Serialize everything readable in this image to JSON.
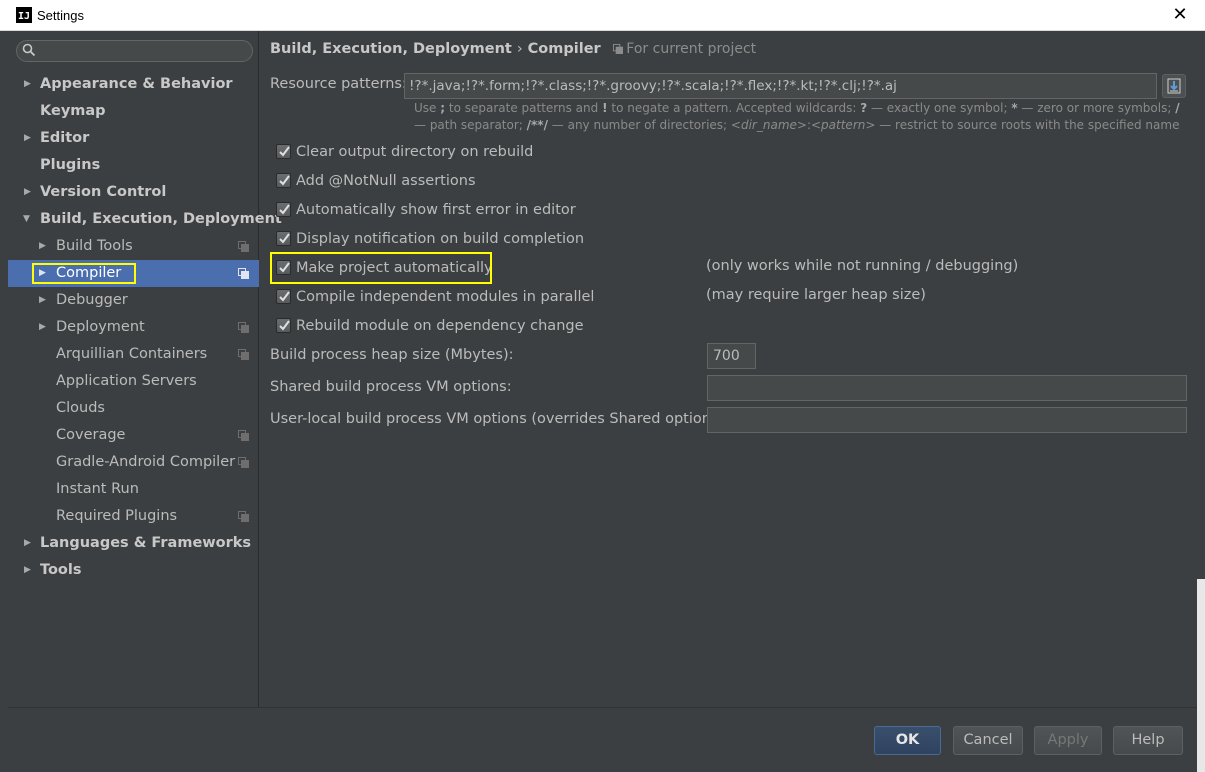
{
  "window": {
    "title": "Settings"
  },
  "search": {
    "placeholder": ""
  },
  "sidebar": {
    "items": [
      {
        "label": "Appearance & Behavior",
        "arrow": "▶"
      },
      {
        "label": "Keymap"
      },
      {
        "label": "Editor",
        "arrow": "▶"
      },
      {
        "label": "Plugins"
      },
      {
        "label": "Version Control",
        "arrow": "▶"
      },
      {
        "label": "Build, Execution, Deployment",
        "arrow": "▼"
      },
      {
        "label": "Build Tools",
        "arrow": "▶"
      },
      {
        "label": "Compiler",
        "arrow": "▶"
      },
      {
        "label": "Debugger",
        "arrow": "▶"
      },
      {
        "label": "Deployment",
        "arrow": "▶"
      },
      {
        "label": "Arquillian Containers"
      },
      {
        "label": "Application Servers"
      },
      {
        "label": "Clouds"
      },
      {
        "label": "Coverage"
      },
      {
        "label": "Gradle-Android Compiler"
      },
      {
        "label": "Instant Run"
      },
      {
        "label": "Required Plugins"
      },
      {
        "label": "Languages & Frameworks",
        "arrow": "▶"
      },
      {
        "label": "Tools",
        "arrow": "▶"
      }
    ],
    "selected": "Compiler"
  },
  "breadcrumb": {
    "parent": "Build, Execution, Deployment",
    "separator": "›",
    "current": "Compiler",
    "scope": "For current project"
  },
  "resource_patterns": {
    "label": "Resource patterns:",
    "value": "!?*.java;!?*.form;!?*.class;!?*.groovy;!?*.scala;!?*.flex;!?*.kt;!?*.clj;!?*.aj",
    "hint": {
      "t1": "Use ",
      "k1": ";",
      "t2": " to separate patterns and ",
      "k2": "!",
      "t3": " to negate a pattern. Accepted wildcards: ",
      "k3": "?",
      "t4": " — exactly one symbol; ",
      "k4": "*",
      "t5": " — zero or more symbols; ",
      "k5": "/",
      "t6": " — path separator; ",
      "k6": "/**/",
      "t7": " — any number of directories; ",
      "i1": "<dir_name>",
      "t8": ":",
      "i2": "<pattern>",
      "t9": " — restrict to source roots with the specified name"
    }
  },
  "options": {
    "clear_output": {
      "label": "Clear output directory on rebuild",
      "checked": true
    },
    "notnull": {
      "label": "Add @NotNull assertions",
      "checked": true
    },
    "show_first_error": {
      "label": "Automatically show first error in editor",
      "checked": true
    },
    "notification": {
      "label": "Display notification on build completion",
      "checked": true
    },
    "make_auto": {
      "label": "Make project automatically",
      "checked": true,
      "note": "(only works while not running / debugging)"
    },
    "parallel": {
      "label": "Compile independent modules in parallel",
      "checked": true,
      "note": "(may require larger heap size)"
    },
    "rebuild_dep": {
      "label": "Rebuild module on dependency change",
      "checked": true
    }
  },
  "heap": {
    "label": "Build process heap size (Mbytes):",
    "value": "700"
  },
  "shared_vm": {
    "label": "Shared build process VM options:",
    "value": ""
  },
  "local_vm": {
    "label": "User-local build process VM options (overrides Shared options):",
    "value": ""
  },
  "footer": {
    "ok": "OK",
    "cancel": "Cancel",
    "apply": "Apply",
    "help": "Help"
  },
  "colors": {
    "selection": "#4b6eaf",
    "highlight": "#ffff00",
    "background": "#3c3f41"
  }
}
